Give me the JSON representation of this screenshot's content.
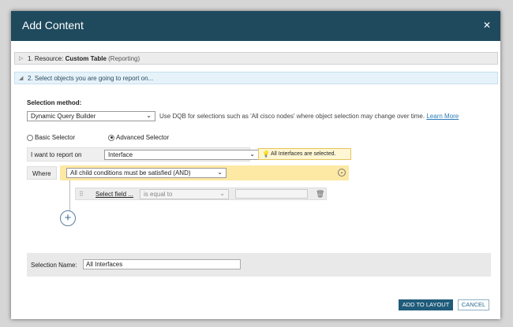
{
  "dialog": {
    "title": "Add Content",
    "close_glyph": "✕"
  },
  "steps": [
    {
      "prefix": "1. Resource:",
      "name": "Custom Table",
      "suffix": "(Reporting)",
      "state": "collapsed"
    },
    {
      "label": "2. Select objects you are going to report on...",
      "state": "expanded"
    }
  ],
  "selection": {
    "method_label": "Selection method:",
    "method_value": "Dynamic Query Builder",
    "hint": "Use DQB for selections such as 'All cisco nodes' where object selection may change over time.",
    "learn_more": "Learn More",
    "radio_basic": "Basic Selector",
    "radio_advanced": "Advanced Selector",
    "selected_radio": "advanced",
    "report_on_label": "I want to report on",
    "report_on_value": "Interface",
    "note": "All Interfaces are selected."
  },
  "where": {
    "label": "Where",
    "condition_mode": "All child conditions must be satisfied (AND)",
    "row": {
      "field": "Select field ...",
      "operator": "is equal to",
      "value": ""
    }
  },
  "name": {
    "label": "Selection Name:",
    "value": "All Interfaces"
  },
  "buttons": {
    "add": "ADD TO LAYOUT",
    "cancel": "CANCEL"
  },
  "colors": {
    "titlebar": "#1f4a5e",
    "accent": "#1f5b7a",
    "where_bar": "#fde8a4",
    "link": "#2b7bb9"
  }
}
